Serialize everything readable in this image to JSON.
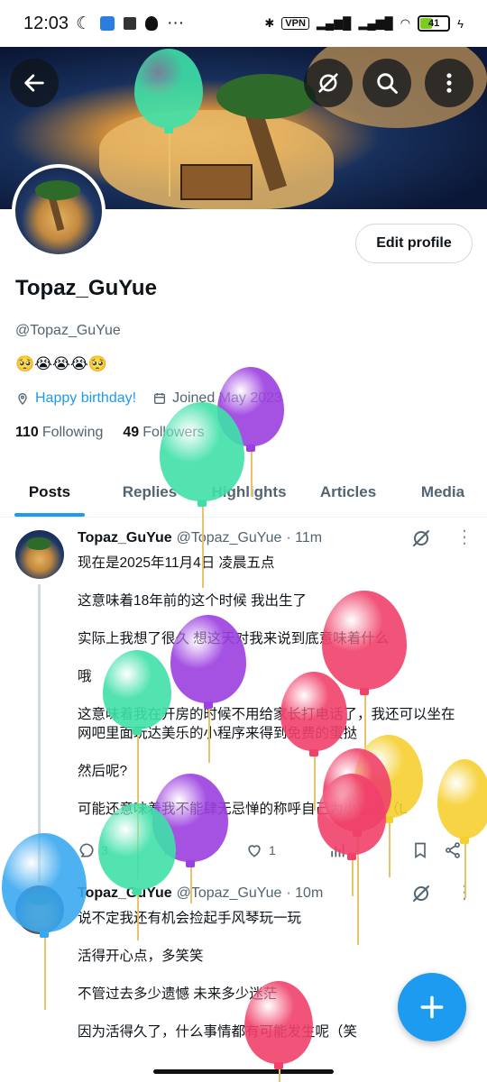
{
  "status_bar": {
    "time": "12:03",
    "vpn": "VPN",
    "battery": "41",
    "more": "···"
  },
  "profile": {
    "display_name": "Topaz_GuYue",
    "handle": "@Topaz_GuYue",
    "bio": "🥺😭😭😭🥺",
    "birthday": "Happy birthday!",
    "joined": "Joined May 2023",
    "following_count": "110",
    "following_label": "Following",
    "followers_count": "49",
    "followers_label": "Followers",
    "edit_label": "Edit profile"
  },
  "tabs": [
    {
      "label": "Posts"
    },
    {
      "label": "Replies"
    },
    {
      "label": "Highlights"
    },
    {
      "label": "Articles"
    },
    {
      "label": "Media"
    }
  ],
  "tweets": [
    {
      "name": "Topaz_GuYue",
      "handle": "@Topaz_GuYue",
      "time": "· 11m",
      "paragraphs": [
        "现在是2025年11月4日 凌晨五点",
        "这意味着18年前的这个时候 我出生了",
        "实际上我想了很久 想这天对我来说到底意味着什么",
        "哦",
        "这意味着我在开房的时候不用给家长打电话了，我还可以坐在网吧里面玩达美乐的小程序来得到免费的蛋挞",
        "然后呢?",
        "可能还意味着我不能肆无忌惮的称呼自己为小登了（L"
      ],
      "replies": "3",
      "retweets": "",
      "likes": "1",
      "views": ""
    },
    {
      "name": "Topaz_GuYue",
      "handle": "@Topaz_GuYue",
      "time": "· 10m",
      "paragraphs": [
        "说不定我还有机会捡起手风琴玩一玩",
        "活得开心点，多笑笑",
        "不管过去多少遗憾 未来多少迷茫",
        "因为活得久了，什么事情都有可能发生呢（笑"
      ]
    }
  ],
  "colors": {
    "accent": "#1d9bf0",
    "balloon_green": "#3fe0a8",
    "balloon_purple": "#9b3fe0",
    "balloon_pink": "#f0416a",
    "balloon_yellow": "#f5cf2e",
    "balloon_blue": "#3aa8f0"
  },
  "icons": {
    "back": "arrow-left-icon",
    "grok": "grok-icon",
    "search": "search-icon",
    "more": "more-vertical-icon",
    "location": "location-pin-icon",
    "calendar": "calendar-icon",
    "compose": "plus-icon"
  }
}
